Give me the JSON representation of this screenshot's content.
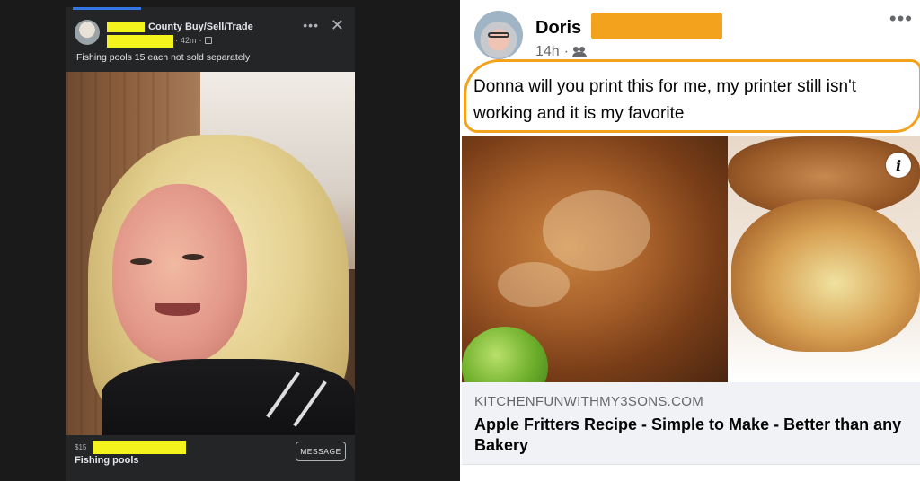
{
  "left_post": {
    "group_name": "County Buy/Sell/Trade",
    "time": "42m",
    "caption": "Fishing pools 15 each not sold separately",
    "price": "$15",
    "item_name": "Fishing pools",
    "message_label": "MESSAGE",
    "menu_icon": "more-dots-icon",
    "close_icon": "close-icon",
    "redaction_color": "#f5f31d"
  },
  "right_post": {
    "author_name": "Doris",
    "time": "14h",
    "audience_icon": "friends-icon",
    "menu_icon": "more-dots-icon",
    "text": "Donna will you print this for me, my printer still isn't working and it is my favorite",
    "highlight_color": "#f2a21c",
    "link_domain": "KITCHENFUNWITHMY3SONS.COM",
    "link_title": "Apple Fritters Recipe - Simple to Make - Better than any Bakery",
    "info_label": "i"
  }
}
